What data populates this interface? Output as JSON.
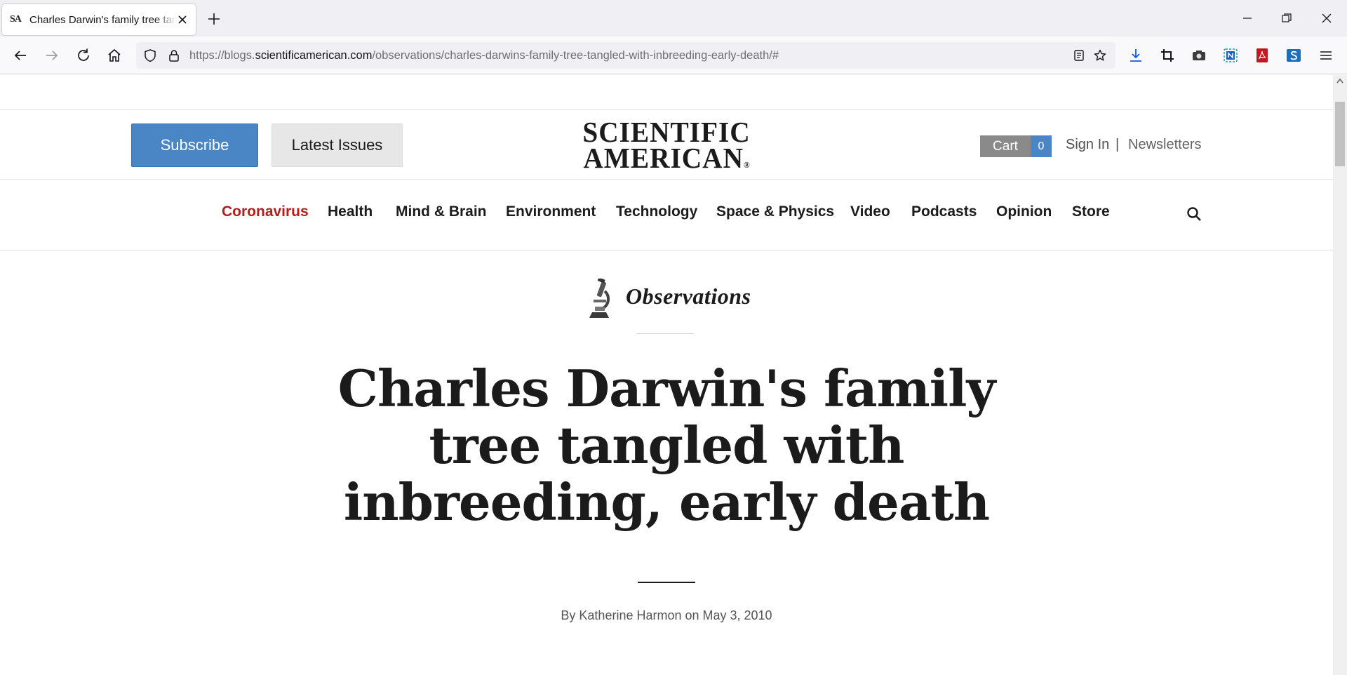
{
  "browser": {
    "tab": {
      "favicon": "SA",
      "title": "Charles Darwin's family tree tangled with inbreeding, early death"
    },
    "url": {
      "prefix": "https://blogs.",
      "domain": "scientificamerican.com",
      "path": "/observations/charles-darwins-family-tree-tangled-with-inbreeding-early-death/#"
    },
    "toolbar_icons": [
      "reader-view-icon",
      "bookmark-star-icon",
      "download-icon",
      "crop-icon",
      "screenshot-icon",
      "extension-n-icon",
      "pdf-icon",
      "extension-s-icon",
      "menu-icon"
    ]
  },
  "header": {
    "subscribe_label": "Subscribe",
    "latest_label": "Latest Issues",
    "logo_line1": "SCIENTIFIC",
    "logo_line2": "AMERICAN",
    "logo_reg": "®",
    "cart_label": "Cart",
    "cart_count": "0",
    "signin_label": "Sign In",
    "separator": "|",
    "newsletters_label": "Newsletters"
  },
  "nav": {
    "items": [
      {
        "label": "Coronavirus"
      },
      {
        "label": "Health"
      },
      {
        "label": "Mind & Brain"
      },
      {
        "label": "Environment"
      },
      {
        "label": "Technology"
      },
      {
        "label": "Space & Physics"
      },
      {
        "label": "Video"
      },
      {
        "label": "Podcasts"
      },
      {
        "label": "Opinion"
      },
      {
        "label": "Store"
      }
    ]
  },
  "article": {
    "blog_name": "Observations",
    "title": "Charles Darwin's family tree tangled with inbreeding, early death",
    "byline": "By Katherine Harmon on May 3, 2010"
  },
  "colors": {
    "accent": "#4a86c5",
    "hot": "#b51d1d"
  }
}
